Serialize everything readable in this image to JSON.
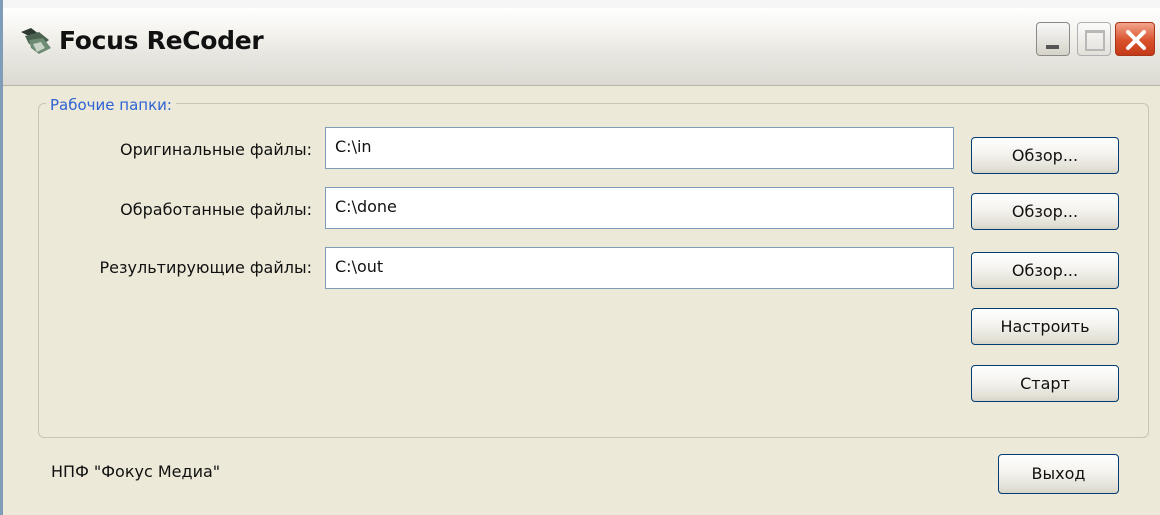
{
  "window": {
    "title": "Focus ReCoder",
    "icon": "focus-recoder-app-icon",
    "controls": {
      "minimize_icon": "minimize-icon",
      "maximize_icon": "maximize-icon",
      "close_icon": "close-icon",
      "close_color": "#d9512c"
    }
  },
  "folders_group": {
    "legend": "Рабочие папки:",
    "legend_color": "#2e62d4",
    "rows": [
      {
        "label": "Оригинальные файлы:",
        "value": "C:\\in",
        "browse_label": "Обзор..."
      },
      {
        "label": "Обработанные файлы:",
        "value": "C:\\done",
        "browse_label": "Обзор..."
      },
      {
        "label": "Результирующие файлы:",
        "value": "C:\\out",
        "browse_label": "Обзор..."
      }
    ],
    "configure_label": "Настроить",
    "start_label": "Старт"
  },
  "footer": {
    "company": "НПФ \"Фокус Медиа\"",
    "exit_label": "Выход"
  },
  "colors": {
    "window_background": "#ece9d8",
    "input_border": "#7f9db9",
    "button_border": "#003c74"
  }
}
